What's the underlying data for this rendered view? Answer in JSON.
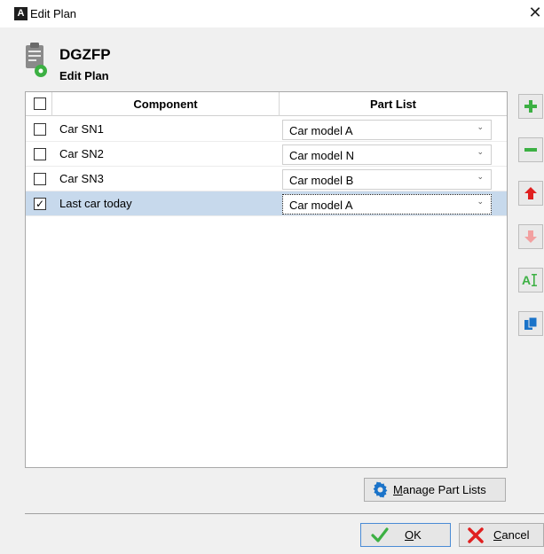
{
  "window": {
    "title": "Edit Plan",
    "app_glyph": "A",
    "close_glyph": "✕"
  },
  "header": {
    "plan_name": "DGZFP",
    "subtitle": "Edit Plan",
    "icon": "clipboard-gear-icon"
  },
  "grid": {
    "columns": {
      "component": "Component",
      "part_list": "Part List"
    },
    "header_checked": false,
    "rows": [
      {
        "checked": false,
        "component": "Car SN1",
        "part_list": "Car model A",
        "selected": false
      },
      {
        "checked": false,
        "component": "Car SN2",
        "part_list": "Car model N",
        "selected": false
      },
      {
        "checked": false,
        "component": "Car SN3",
        "part_list": "Car model B",
        "selected": false
      },
      {
        "checked": true,
        "component": "Last car today",
        "part_list": "Car model A",
        "selected": true
      }
    ]
  },
  "side_toolbar": [
    {
      "name": "add-row-button",
      "icon": "plus-icon",
      "enabled": true
    },
    {
      "name": "remove-row-button",
      "icon": "minus-icon",
      "enabled": true
    },
    {
      "name": "move-up-button",
      "icon": "arrow-up-icon",
      "enabled": true
    },
    {
      "name": "move-down-button",
      "icon": "arrow-down-icon",
      "enabled": false
    },
    {
      "name": "rename-button",
      "icon": "text-cursor-icon",
      "enabled": true
    },
    {
      "name": "copy-button",
      "icon": "copy-icon",
      "enabled": true
    }
  ],
  "buttons": {
    "manage_mnemonic": "M",
    "manage_rest": "anage Part Lists",
    "ok_mnemonic": "O",
    "ok_rest": "K",
    "cancel_mnemonic": "C",
    "cancel_rest": "ancel"
  },
  "colors": {
    "selection": "#c7d9ec",
    "accent_green": "#3cb043",
    "accent_red": "#e02020",
    "accent_blue": "#1a73c9"
  },
  "glyphs": {
    "check": "✓",
    "chevron": "⌄"
  }
}
